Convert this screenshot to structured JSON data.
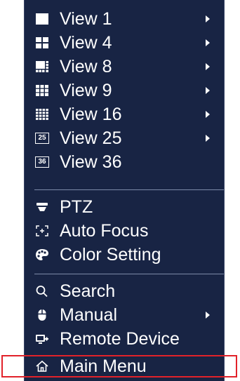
{
  "menu": {
    "items": [
      {
        "label": "View 1",
        "icon": "view-1-icon",
        "submenu": true
      },
      {
        "label": "View 4",
        "icon": "view-4-icon",
        "submenu": true
      },
      {
        "label": "View 8",
        "icon": "view-8-icon",
        "submenu": true
      },
      {
        "label": "View 9",
        "icon": "view-9-icon",
        "submenu": true
      },
      {
        "label": "View 16",
        "icon": "view-16-icon",
        "submenu": true
      },
      {
        "label": "View 25",
        "icon": "view-25-icon",
        "submenu": true
      },
      {
        "label": "View 36",
        "icon": "view-36-icon",
        "submenu": false
      },
      {
        "label": "PTZ",
        "icon": "ptz-icon",
        "submenu": false
      },
      {
        "label": "Auto Focus",
        "icon": "auto-focus-icon",
        "submenu": false
      },
      {
        "label": "Color Setting",
        "icon": "color-palette-icon",
        "submenu": false
      },
      {
        "label": "Search",
        "icon": "search-icon",
        "submenu": false
      },
      {
        "label": "Manual",
        "icon": "mouse-icon",
        "submenu": true
      },
      {
        "label": "Remote Device",
        "icon": "remote-device-icon",
        "submenu": false
      },
      {
        "label": "Main Menu",
        "icon": "home-icon",
        "submenu": false
      }
    ],
    "view25_badge": "25",
    "view36_badge": "36",
    "highlighted_item": "Main Menu"
  },
  "colors": {
    "menu_background": "#182444",
    "text": "#ffffff",
    "separator": "#7d8aa8",
    "highlight_border": "#e2222a"
  }
}
